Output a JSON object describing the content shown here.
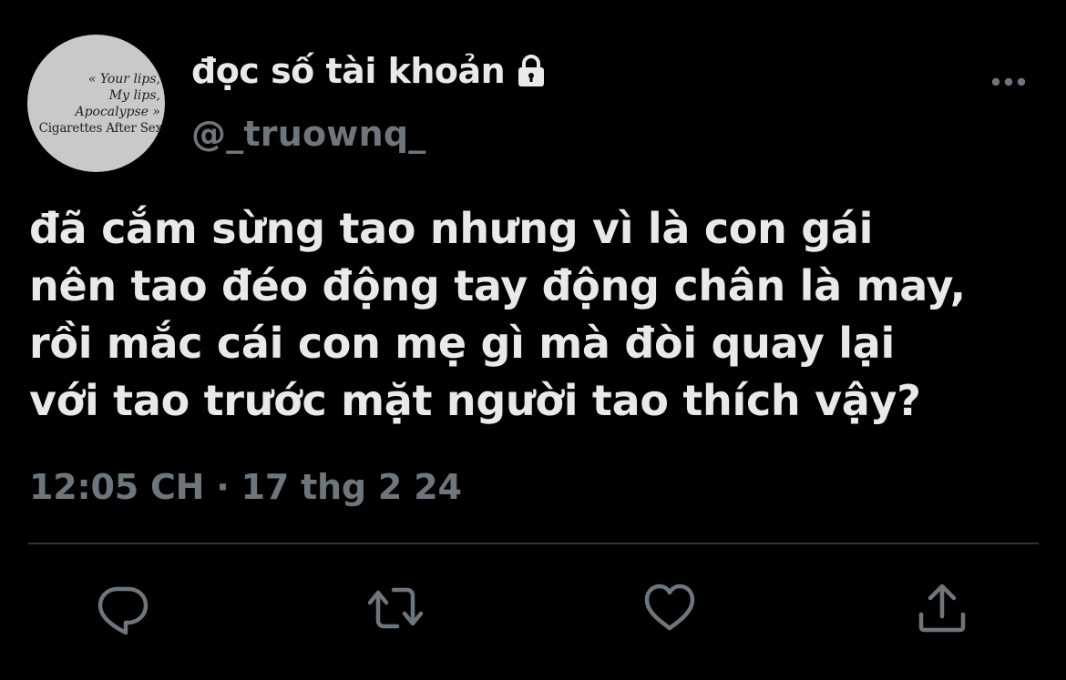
{
  "avatar": {
    "lines": [
      "« Your lips,",
      "My lips,",
      "Apocalypse »",
      "Cigarettes After Sex"
    ]
  },
  "author": {
    "display_name": "đọc số tài khoản",
    "handle": "@_truownq_",
    "badge_icon": "lock-icon"
  },
  "tweet": {
    "lines": [
      "đã cắm sừng tao nhưng vì là con gái",
      "nên tao đéo động tay động chân là may,",
      "rồi mắc cái con mẹ gì mà đòi quay lại",
      "với tao trước mặt người tao thích vậy?"
    ],
    "timestamp": "12:05 CH · 17 thg 2 24"
  },
  "actions": [
    {
      "icon": "reply-icon"
    },
    {
      "icon": "retweet-icon"
    },
    {
      "icon": "like-icon"
    },
    {
      "icon": "share-icon"
    }
  ],
  "colors": {
    "background": "#000000",
    "primary_text": "#e7e9ea",
    "secondary_text": "#6e767d",
    "divider": "#2f3336"
  }
}
